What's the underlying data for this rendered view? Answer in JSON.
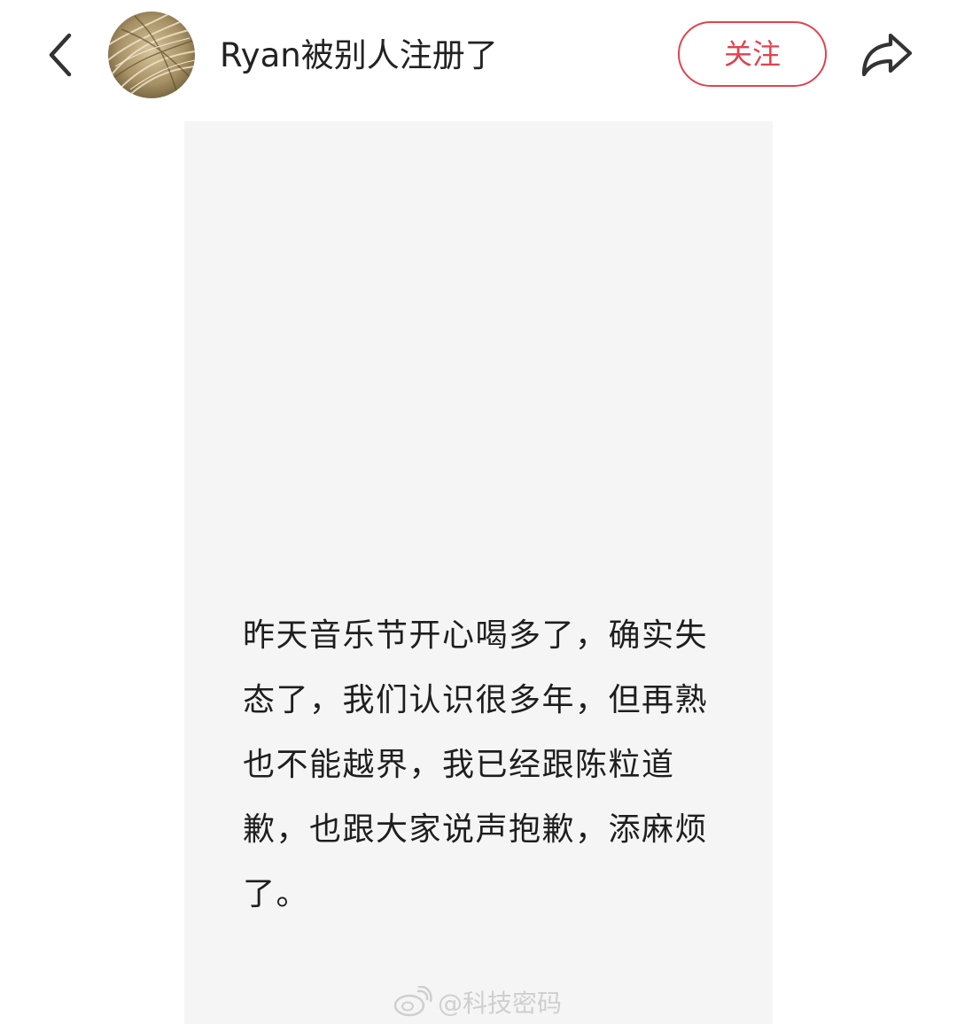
{
  "header": {
    "back_icon": "chevron-left-icon",
    "avatar_icon": "wheat-field-avatar",
    "username": "Ryan被别人注册了",
    "follow_label": "关注",
    "share_icon": "share-arrow-icon"
  },
  "post": {
    "text": "昨天音乐节开心喝多了，确实失态了，我们认识很多年，但再熟也不能越界，我已经跟陈粒道歉，也跟大家说声抱歉，添麻烦了。"
  },
  "watermark": {
    "icon": "weibo-logo-icon",
    "text": "@科技密码"
  },
  "colors": {
    "accent": "#e0434f",
    "card_bg": "#f5f5f5",
    "text": "#1e1e1e"
  }
}
